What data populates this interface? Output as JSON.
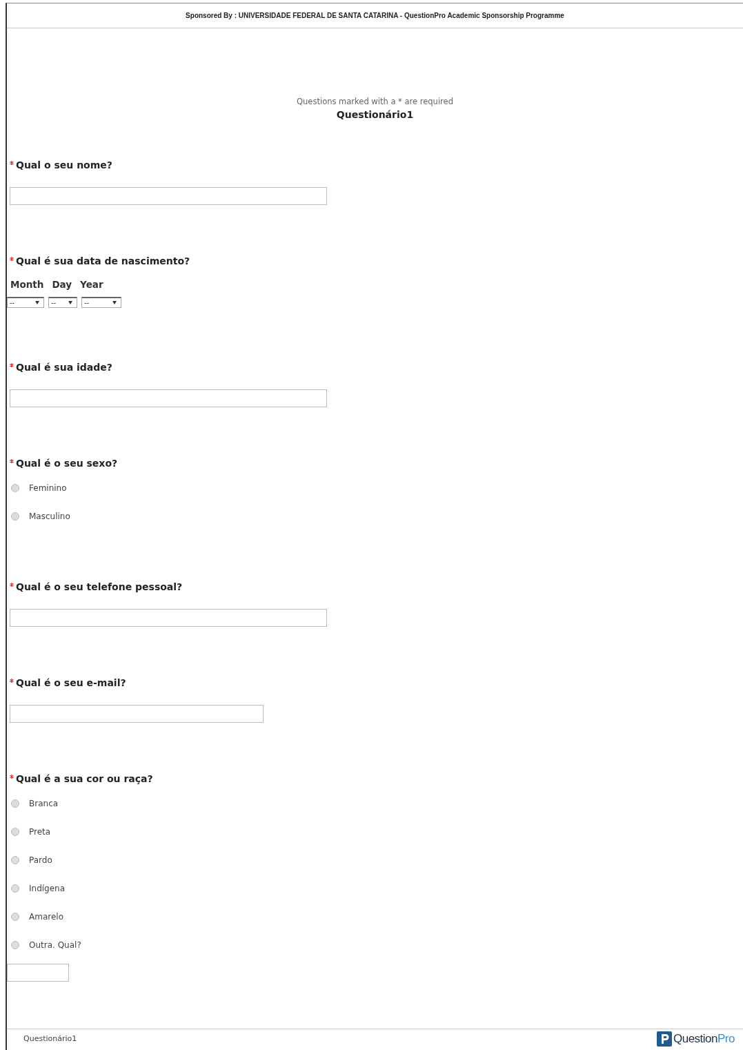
{
  "header": {
    "sponsor": "Sponsored By : UNIVERSIDADE FEDERAL DE SANTA CATARINA - QuestionPro Academic Sponsorship Programme"
  },
  "intro": {
    "note": "Questions marked with a * are required",
    "title": "Questionário1"
  },
  "questions": [
    {
      "kind": "text",
      "required": true,
      "title": "Qual o seu nome?",
      "wide": true
    },
    {
      "kind": "date",
      "required": true,
      "title": "Qual é sua data de nascimento?",
      "parts": [
        {
          "label": "Month",
          "value": "--"
        },
        {
          "label": "Day",
          "value": "--"
        },
        {
          "label": "Year",
          "value": "--"
        }
      ]
    },
    {
      "kind": "text",
      "required": true,
      "title": "Qual é sua idade?",
      "wide": true
    },
    {
      "kind": "radio",
      "required": true,
      "title": "Qual é o seu sexo?",
      "options": [
        {
          "label": "Feminino",
          "selected": false
        },
        {
          "label": "Masculino",
          "selected": false
        }
      ]
    },
    {
      "kind": "text",
      "required": true,
      "title": "Qual é o seu telefone pessoal?",
      "wide": true
    },
    {
      "kind": "text",
      "required": true,
      "title": "Qual é o seu e-mail?",
      "wide": false
    },
    {
      "kind": "radio",
      "required": true,
      "title": "Qual é a sua cor ou raça?",
      "options": [
        {
          "label": "Branca",
          "selected": false
        },
        {
          "label": "Preta",
          "selected": false
        },
        {
          "label": "Pardo",
          "selected": false
        },
        {
          "label": "Indígena",
          "selected": false
        },
        {
          "label": "Amarelo",
          "selected": false
        },
        {
          "label": "Outra. Qual?",
          "selected": false,
          "other_field": true
        }
      ]
    }
  ],
  "footer": {
    "title": "Questionário1",
    "logo": {
      "text": "Question",
      "accent": "Pro"
    }
  }
}
